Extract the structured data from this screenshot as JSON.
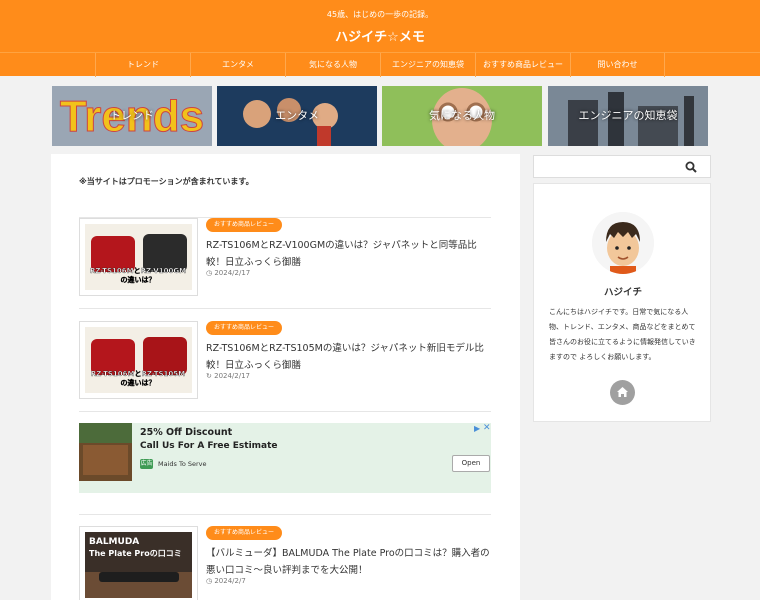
{
  "header": {
    "tagline": "45歳、はじめの一歩の記録。",
    "site_title": "ハジイチ☆メモ"
  },
  "nav": {
    "items": [
      "トレンド",
      "エンタメ",
      "気になる人物",
      "エンジニアの知恵袋",
      "おすすめ商品レビュー",
      "問い合わせ"
    ]
  },
  "banners": [
    {
      "label": "トレンド",
      "logo_text": "Trends"
    },
    {
      "label": "エンタメ"
    },
    {
      "label": "気になる人物"
    },
    {
      "label": "エンジニアの知恵袋"
    }
  ],
  "main": {
    "promo_notice": "※当サイトはプロモーションが含まれています。",
    "posts": [
      {
        "category": "おすすめ商品レビュー",
        "title_line1": "RZ-TS106MとRZ-V100GMの違いは？ジャパネットと同等品比",
        "title_line2": "較！日立ふっくら御膳",
        "date": "2024/2/17",
        "thumb_line1": "RZ-TS106MとRZ-V100GM",
        "thumb_line2": "の違いは？"
      },
      {
        "category": "おすすめ商品レビュー",
        "title_line1": "RZ-TS106MとRZ-TS105Mの違いは？ジャパネット新旧モデル比",
        "title_line2": "較！日立ふっくら御膳",
        "date": "2024/2/17",
        "thumb_line1": "RZ-TS106MとRZ-TS105M",
        "thumb_line2": "の違いは？"
      },
      {
        "category": "おすすめ商品レビュー",
        "title_line1": "【バルミューダ】BALMUDA The Plate Proの口コミは？購入者の",
        "title_line2": "悪い口コミ〜良い評判までを大公開！",
        "date": "2024/2/7",
        "thumb_line1": "BALMUDA",
        "thumb_line2": "The Plate Proの口コミ"
      }
    ]
  },
  "ad": {
    "title": "25% Off Discount",
    "subtitle": "Call Us For A Free Estimate",
    "badge": "広告",
    "brand": "Maids To Serve",
    "button": "Open"
  },
  "sidebar": {
    "profile_name": "ハジイチ",
    "bio": "こんにちはハジイチです。日常で気になる人物、トレンド、エンタメ、商品などをまとめて 皆さんのお役に立てるように情報発信していきますので よろしくお願いします。"
  },
  "colors": {
    "accent": "#ff8c1a",
    "ad_background": "#e4f2e7"
  }
}
